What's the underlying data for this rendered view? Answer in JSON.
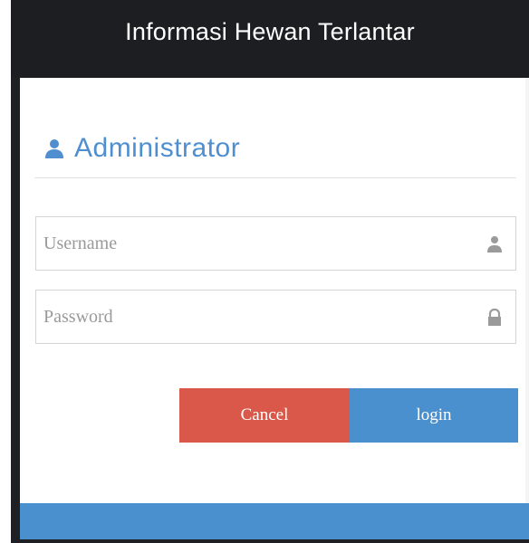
{
  "modal": {
    "title": "Informasi Hewan Terlantar"
  },
  "panel": {
    "heading": "Administrator",
    "heading_icon": "user-icon"
  },
  "form": {
    "username_placeholder": "Username",
    "username_value": "",
    "username_icon": "user-icon",
    "password_placeholder": "Password",
    "password_value": "",
    "password_icon": "lock-icon"
  },
  "buttons": {
    "cancel_label": "Cancel",
    "login_label": "login"
  },
  "colors": {
    "header_bg": "#1c1e21",
    "accent_blue": "#4a8fce",
    "cancel_red": "#d9584a",
    "heading_blue": "#4f8fd0"
  }
}
